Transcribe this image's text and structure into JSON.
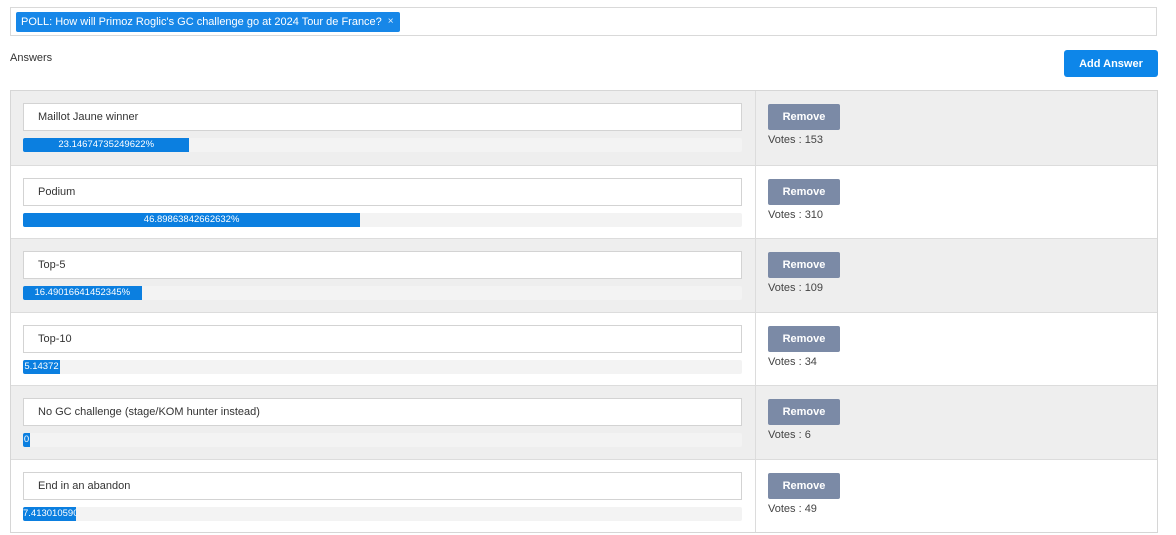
{
  "poll": {
    "tag_label": "POLL: How will Primoz Roglic's GC challenge go at 2024 Tour de France?",
    "tag_close": "×"
  },
  "answers_label": "Answers",
  "add_answer_label": "Add Answer",
  "remove_label": "Remove",
  "colors": {
    "primary": "#0d86e9",
    "remove_button": "#7b8aa6",
    "progress_fill": "#0b7fe0",
    "row_shaded": "#eeeeee"
  },
  "answers": [
    {
      "text": "Maillot Jaune winner",
      "percent_label": "23.14674735249622%",
      "percent": 23.14674735249622,
      "votes_label": "Votes : 153"
    },
    {
      "text": "Podium",
      "percent_label": "46.89863842662632%",
      "percent": 46.89863842662632,
      "votes_label": "Votes : 310"
    },
    {
      "text": "Top-5",
      "percent_label": "16.49016641452345%",
      "percent": 16.49016641452345,
      "votes_label": "Votes : 109"
    },
    {
      "text": "Top-10",
      "percent_label": "5.14372",
      "percent": 5.14372,
      "votes_label": "Votes : 34"
    },
    {
      "text": "No GC challenge (stage/KOM hunter instead)",
      "percent_label": "0",
      "percent": 0.907715582,
      "votes_label": "Votes : 6"
    },
    {
      "text": "End in an abandon",
      "percent_label": "7.413010590",
      "percent": 7.41301059,
      "votes_label": "Votes : 49"
    }
  ]
}
